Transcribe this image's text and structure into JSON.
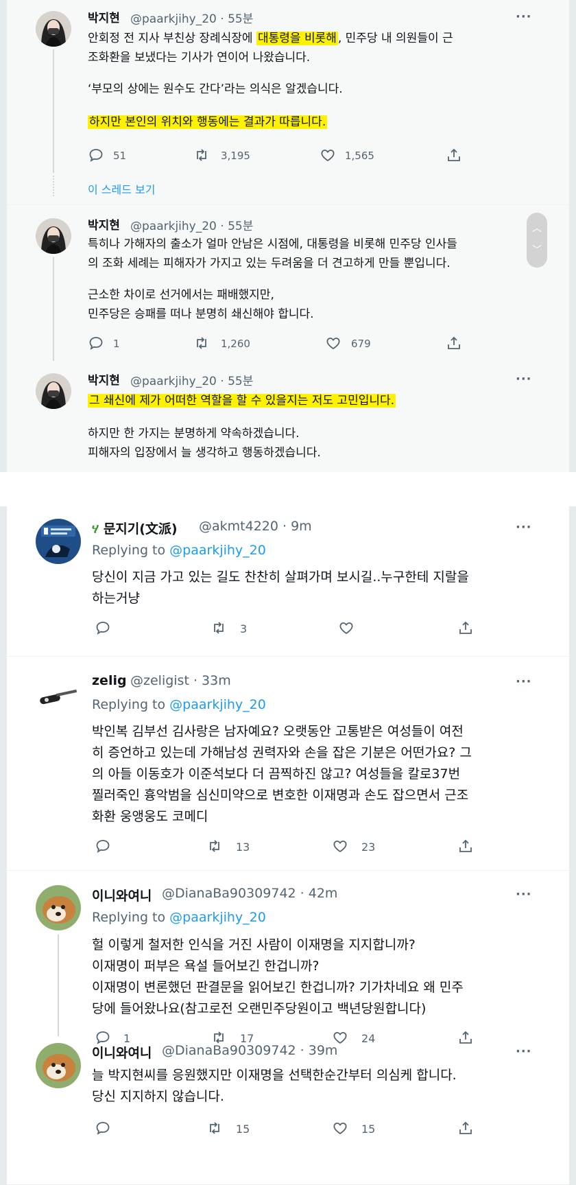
{
  "thread": {
    "tweets": [
      {
        "name": "박지현",
        "handle": "@paarkjihy_20 · 55분",
        "lines": [
          {
            "parts": [
              {
                "t": "안회정 전 지사 부친상 장례식장에 "
              },
              {
                "t": "대통령을 비롯해",
                "hl": true
              },
              {
                "t": ", 민주당 내 의원들이 근"
              }
            ]
          },
          {
            "parts": [
              {
                "t": "조화환을 보냈다는 기사가 연이어 나왔습니다."
              }
            ]
          },
          {
            "parts": [
              {
                "t": "‘부모의 상에는 원수도 간다’라는 의식은 알겠습니다."
              }
            ]
          },
          {
            "parts": [
              {
                "t": "하지만 본인의 위치와 행동에는 결과가 따릅니다.",
                "hl": true
              }
            ]
          }
        ],
        "replies": "51",
        "retweets": "3,195",
        "likes": "1,565"
      },
      {
        "name": "박지현",
        "handle": "@paarkjihy_20 · 55분",
        "lines": [
          {
            "parts": [
              {
                "t": "특히나 가해자의 출소가 얼마 안남은 시점에, 대통령을 비롯해 민주당 인사들"
              }
            ]
          },
          {
            "parts": [
              {
                "t": "의 조화 세례는 피해자가 가지고 있는 두려움을 더 견고하게 만들 뿐입니다."
              }
            ]
          },
          {
            "parts": [
              {
                "t": "근소한 차이로 선거에서는 패배했지만,"
              }
            ]
          },
          {
            "parts": [
              {
                "t": "민주당은 승패를 떠나 분명히 쇄신해야 합니다."
              }
            ]
          }
        ],
        "replies": "1",
        "retweets": "1,260",
        "likes": "679"
      },
      {
        "name": "박지현",
        "handle": "@paarkjihy_20 · 55분",
        "lines": [
          {
            "parts": [
              {
                "t": "그 쇄신에 제가 어떠한 역할을 할 수 있을지는 저도 고민입니다.",
                "hl": true
              }
            ]
          },
          {
            "parts": [
              {
                "t": "하지만 한 가지는 분명하게 약속하겠습니다."
              }
            ]
          },
          {
            "parts": [
              {
                "t": "피해자의 입장에서 늘 생각하고 행동하겠습니다."
              }
            ]
          }
        ]
      }
    ],
    "show_thread": "이 스레드 보기"
  },
  "replies_section": {
    "replying_prefix": "Replying to ",
    "replying_handle": "@paarkjihy_20",
    "items": [
      {
        "name": "문지기(文派)",
        "handle": "@akmt4220 · 9m",
        "lines": [
          "당신이 지금 가고 있는 길도 찬찬히 살펴가며 보시길..누구한테 지랄을",
          "하는거냥"
        ],
        "replies": "",
        "retweets": "3",
        "likes": ""
      },
      {
        "name": "zelig",
        "handle": "@zeligist · 33m",
        "lines": [
          "박인복 김부선 김사랑은 남자예요? 오랫동안 고통받은 여성들이 여전",
          "히 증언하고 있는데 가해남성 권력자와 손을 잡은 기분은 어떤가요? 그",
          "의 아들 이동호가 이준석보다 더 끔찍하진 않고? 여성들을 칼로37번",
          "찔러죽인 흉악범을 심신미약으로 변호한 이재명과 손도 잡으면서 근조",
          "화환 웅앵웅도 코메디"
        ],
        "replies": "",
        "retweets": "13",
        "likes": "23"
      },
      {
        "name": "이니와여니",
        "handle": "@DianaBa90309742 · 42m",
        "lines": [
          "헐 이렇게 철저한 인식을 거진 사람이 이재명을 지지합니까?",
          "이재명이  퍼부은 욕설 들어보긴 한겁니까?",
          "이재명이 변론했던 판결문을 읽어보긴 한겁니까? 기가차네요 왜 민주",
          "당에 들어왔나요(참고로전 오랜민주당원이고 백년당원합니다)"
        ],
        "replies": "1",
        "retweets": "17",
        "likes": "24"
      },
      {
        "name": "이니와여니",
        "handle": "@DianaBa90309742 · 39m",
        "lines": [
          "늘 박지현씨를 응원했지만 이재명을 선택한순간부터 의심케 합니다.",
          "당신 지지하지 않습니다."
        ],
        "replies": "",
        "retweets": "15",
        "likes": "15"
      }
    ]
  },
  "more_label": "···",
  "icons": {
    "reply": "reply-icon",
    "retweet": "retweet-icon",
    "like": "heart-icon",
    "share": "share-icon",
    "more": "more-icon"
  },
  "colors": {
    "highlight": "#fff200",
    "link": "#1d9bf0",
    "secondary": "#536471"
  }
}
